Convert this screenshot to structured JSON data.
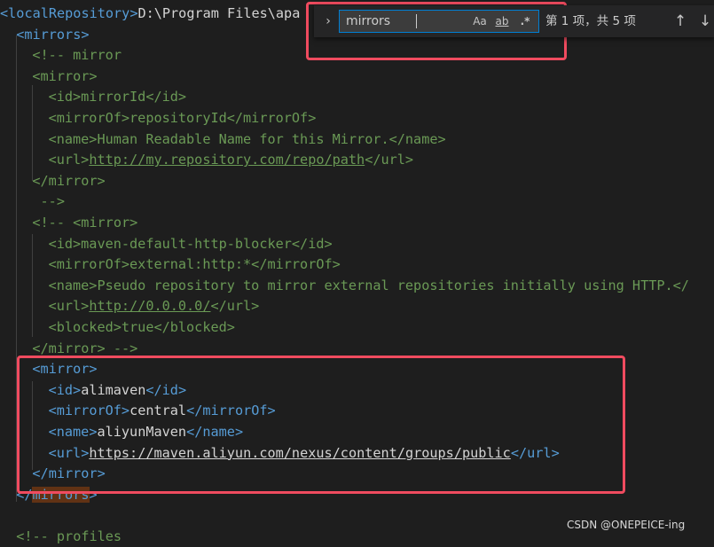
{
  "editor": {
    "lines": [
      {
        "indent": 0,
        "tokens": [
          {
            "c": "tag",
            "t": "<"
          },
          {
            "c": "tagname",
            "t": "localRepository"
          },
          {
            "c": "tag",
            "t": ">"
          },
          {
            "c": "text",
            "t": "D:\\Program Files\\apa"
          }
        ]
      },
      {
        "indent": 1,
        "tokens": [
          {
            "c": "tag",
            "t": "<"
          },
          {
            "c": "tagname",
            "t": "mirrors"
          },
          {
            "c": "tag",
            "t": ">"
          }
        ]
      },
      {
        "indent": 2,
        "tokens": [
          {
            "c": "comment",
            "t": "<!-- mirror"
          }
        ]
      },
      {
        "indent": 2,
        "tokens": [
          {
            "c": "comment",
            "t": "<mirror>"
          }
        ]
      },
      {
        "indent": 3,
        "tokens": [
          {
            "c": "comment",
            "t": "<id>mirrorId</id>"
          }
        ]
      },
      {
        "indent": 3,
        "tokens": [
          {
            "c": "comment",
            "t": "<mirrorOf>repositoryId</mirrorOf>"
          }
        ]
      },
      {
        "indent": 3,
        "tokens": [
          {
            "c": "comment",
            "t": "<name>Human Readable Name for this Mirror.</name>"
          }
        ]
      },
      {
        "indent": 3,
        "tokens": [
          {
            "c": "comment",
            "t": "<url>"
          },
          {
            "c": "comment link",
            "t": "http://my.repository.com/repo/path"
          },
          {
            "c": "comment",
            "t": "</url>"
          }
        ]
      },
      {
        "indent": 2,
        "tokens": [
          {
            "c": "comment",
            "t": "</mirror>"
          }
        ]
      },
      {
        "indent": 2,
        "tokens": [
          {
            "c": "comment",
            "t": " -->"
          }
        ]
      },
      {
        "indent": 2,
        "tokens": [
          {
            "c": "comment",
            "t": "<!-- <mirror>"
          }
        ]
      },
      {
        "indent": 3,
        "tokens": [
          {
            "c": "comment",
            "t": "<id>maven-default-http-blocker</id>"
          }
        ]
      },
      {
        "indent": 3,
        "tokens": [
          {
            "c": "comment",
            "t": "<mirrorOf>external:http:*</mirrorOf>"
          }
        ]
      },
      {
        "indent": 3,
        "tokens": [
          {
            "c": "comment",
            "t": "<name>Pseudo repository to mirror external repositories initially using HTTP.</"
          }
        ]
      },
      {
        "indent": 3,
        "tokens": [
          {
            "c": "comment",
            "t": "<url>"
          },
          {
            "c": "comment link",
            "t": "http://0.0.0.0/"
          },
          {
            "c": "comment",
            "t": "</url>"
          }
        ]
      },
      {
        "indent": 3,
        "tokens": [
          {
            "c": "comment",
            "t": "<blocked>true</blocked>"
          }
        ]
      },
      {
        "indent": 2,
        "tokens": [
          {
            "c": "comment",
            "t": "</mirror> -->"
          }
        ]
      },
      {
        "indent": 2,
        "tokens": [
          {
            "c": "tag",
            "t": "<"
          },
          {
            "c": "tagname",
            "t": "mirror"
          },
          {
            "c": "tag",
            "t": ">"
          }
        ]
      },
      {
        "indent": 3,
        "tokens": [
          {
            "c": "tag",
            "t": "<"
          },
          {
            "c": "tagname",
            "t": "id"
          },
          {
            "c": "tag",
            "t": ">"
          },
          {
            "c": "text",
            "t": "alimaven"
          },
          {
            "c": "tag",
            "t": "</"
          },
          {
            "c": "tagname",
            "t": "id"
          },
          {
            "c": "tag",
            "t": ">"
          }
        ]
      },
      {
        "indent": 3,
        "tokens": [
          {
            "c": "tag",
            "t": "<"
          },
          {
            "c": "tagname",
            "t": "mirrorOf"
          },
          {
            "c": "tag",
            "t": ">"
          },
          {
            "c": "text",
            "t": "central"
          },
          {
            "c": "tag",
            "t": "</"
          },
          {
            "c": "tagname",
            "t": "mirrorOf"
          },
          {
            "c": "tag",
            "t": ">"
          }
        ]
      },
      {
        "indent": 3,
        "tokens": [
          {
            "c": "tag",
            "t": "<"
          },
          {
            "c": "tagname",
            "t": "name"
          },
          {
            "c": "tag",
            "t": ">"
          },
          {
            "c": "text",
            "t": "aliyunMaven"
          },
          {
            "c": "tag",
            "t": "</"
          },
          {
            "c": "tagname",
            "t": "name"
          },
          {
            "c": "tag",
            "t": ">"
          }
        ]
      },
      {
        "indent": 3,
        "tokens": [
          {
            "c": "tag",
            "t": "<"
          },
          {
            "c": "tagname",
            "t": "url"
          },
          {
            "c": "tag",
            "t": ">"
          },
          {
            "c": "text link",
            "t": "https://maven.aliyun.com/nexus/content/groups/public"
          },
          {
            "c": "tag",
            "t": "</"
          },
          {
            "c": "tagname",
            "t": "url"
          },
          {
            "c": "tag",
            "t": ">"
          }
        ]
      },
      {
        "indent": 2,
        "tokens": [
          {
            "c": "tag",
            "t": "</"
          },
          {
            "c": "tagname",
            "t": "mirror"
          },
          {
            "c": "tag",
            "t": ">"
          }
        ]
      },
      {
        "indent": 1,
        "tokens": [
          {
            "c": "tag",
            "t": "</"
          },
          {
            "c": "tagname match",
            "t": "mirrors"
          },
          {
            "c": "tag",
            "t": ">"
          }
        ]
      },
      {
        "indent": 0,
        "tokens": []
      },
      {
        "indent": 1,
        "tokens": [
          {
            "c": "comment",
            "t": "<!-- profiles"
          }
        ]
      }
    ]
  },
  "find_widget": {
    "query": "mirrors",
    "match_case_label": "Aa",
    "whole_word_label": "ab",
    "regex_label": ".*",
    "match_count": "第 1 项，共 5 项",
    "toggle_replace_icon": "chevron-right-icon",
    "prev_icon": "arrow-up-icon",
    "next_icon": "arrow-down-icon"
  },
  "watermark": "CSDN @ONEPEICE-ing",
  "colors": {
    "highlight_border": "#f04b5f",
    "tag": "#569cd6",
    "comment": "#6a9955",
    "text": "#d4d4d4"
  }
}
